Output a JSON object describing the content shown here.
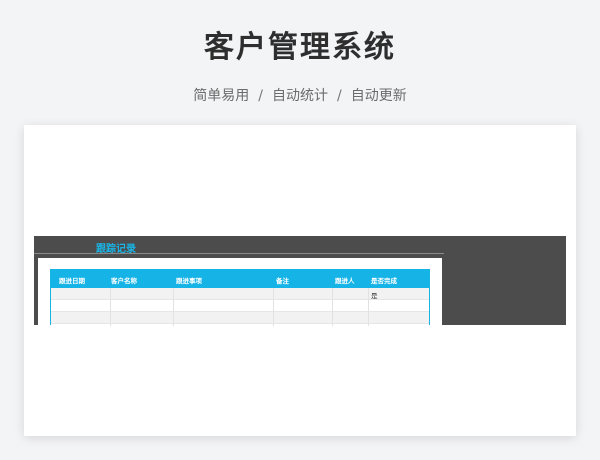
{
  "header": {
    "title": "客户管理系统",
    "features": [
      "简单易用",
      "自动统计",
      "自动更新"
    ],
    "separator": "/"
  },
  "sheet": {
    "tab_title": "跟踪记录",
    "columns": [
      "跟进日期",
      "客户名称",
      "跟进事项",
      "备注",
      "跟进人",
      "是否完成"
    ],
    "rows": [
      [
        "",
        "",
        "",
        "",
        "",
        "是"
      ],
      [
        "",
        "",
        "",
        "",
        "",
        ""
      ],
      [
        "",
        "",
        "",
        "",
        "",
        ""
      ]
    ]
  },
  "colors": {
    "accent": "#15b3e6",
    "dark_band": "#4c4c4c",
    "page_bg": "#f3f4f6"
  }
}
